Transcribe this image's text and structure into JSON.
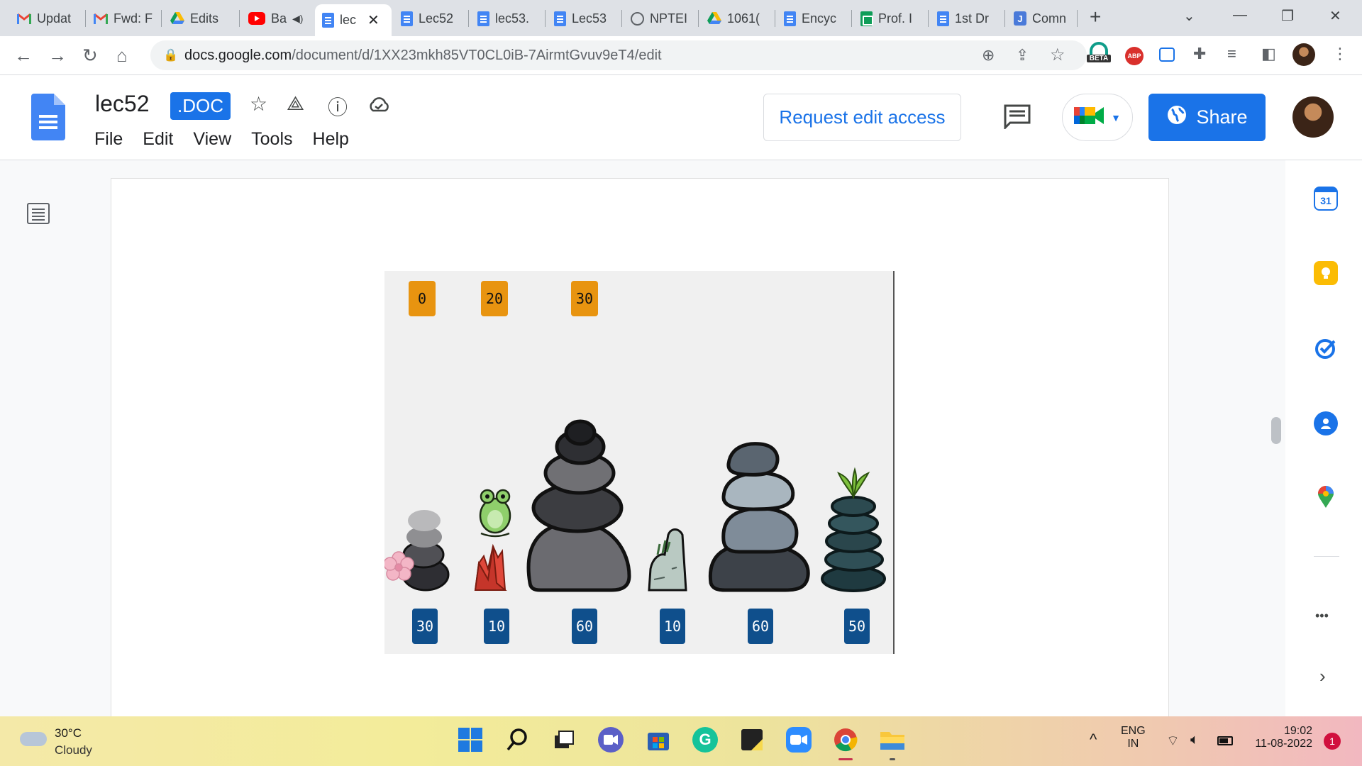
{
  "browser": {
    "tabs": [
      {
        "label": "Updat",
        "icon": "gmail-icon"
      },
      {
        "label": "Fwd: F",
        "icon": "gmail-icon"
      },
      {
        "label": "Edits",
        "icon": "google-drive-icon"
      },
      {
        "label": "Ba",
        "icon": "youtube-icon"
      },
      {
        "label": "lec",
        "icon": "google-docs-icon",
        "active": true
      },
      {
        "label": "Lec52",
        "icon": "google-docs-icon"
      },
      {
        "label": "lec53.",
        "icon": "google-docs-icon"
      },
      {
        "label": "Lec53",
        "icon": "google-docs-icon"
      },
      {
        "label": "NPTEI",
        "icon": "globe-icon"
      },
      {
        "label": "1061(",
        "icon": "google-drive-icon"
      },
      {
        "label": "Encyc",
        "icon": "google-docs-icon"
      },
      {
        "label": "Prof. I",
        "icon": "google-sheets-icon"
      },
      {
        "label": "1st Dr",
        "icon": "google-docs-icon"
      },
      {
        "label": "Comn",
        "icon": "jamboard-icon"
      }
    ],
    "url_domain": "docs.google.com",
    "url_path": "/document/d/1XX23mkh85VT0CL0iB-7AirmtGvuv9eT4/edit",
    "extension_badge": "BETA",
    "abp_label": "ABP"
  },
  "doc": {
    "title": "lec52",
    "extension": ".DOC",
    "menu": [
      "File",
      "Edit",
      "View",
      "Tools",
      "Help"
    ],
    "request_access_label": "Request edit access",
    "share_label": "Share"
  },
  "figure": {
    "top_badges": [
      "0",
      "20",
      "30"
    ],
    "bottom_badges": [
      "30",
      "10",
      "60",
      "10",
      "60",
      "50"
    ],
    "colors": {
      "top_badge": "#e89410",
      "bottom_badge": "#0f4f8c"
    }
  },
  "side_panel": {
    "calendar_day": "31",
    "more_label": "•••"
  },
  "taskbar": {
    "weather_temp": "30°C",
    "weather_desc": "Cloudy",
    "lang_top": "ENG",
    "lang_bottom": "IN",
    "time": "19:02",
    "date": "11-08-2022",
    "notifications": "1"
  }
}
